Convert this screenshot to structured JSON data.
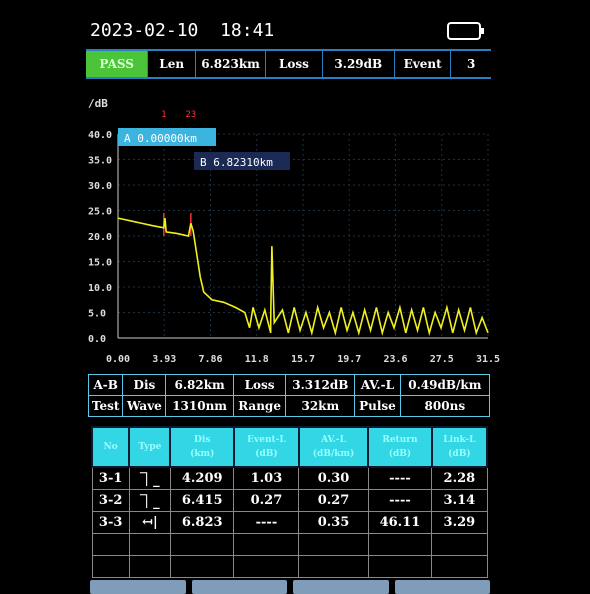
{
  "header": {
    "date": "2023-02-10",
    "time": "18:41",
    "battery_icon": "battery-icon"
  },
  "status": {
    "result": "PASS",
    "len_label": "Len",
    "len_value": "6.823km",
    "loss_label": "Loss",
    "loss_value": "3.29dB",
    "event_label": "Event",
    "event_value": "3"
  },
  "chart_data": {
    "type": "line",
    "ylabel": "/dB",
    "ylim": [
      0,
      40
    ],
    "xlim": [
      0,
      31.5
    ],
    "yticks": [
      "40.0",
      "35.0",
      "30.0",
      "25.0",
      "20.0",
      "15.0",
      "10.0",
      "5.0",
      "0.0"
    ],
    "xticks": [
      "0.00",
      "3.93",
      "7.86",
      "11.8",
      "15.7",
      "19.7",
      "23.6",
      "27.5",
      "31.5"
    ],
    "cursor_a": "A 0.00000km",
    "cursor_b": "B 6.82310km",
    "cursor_a_km": 0,
    "cursor_b_km": 6.8231,
    "event_markers": [
      {
        "label": "1",
        "km": 3.9
      },
      {
        "label": "23",
        "km": 6.2
      }
    ],
    "trace_color": "#f0f020",
    "trace": [
      [
        0,
        23.5
      ],
      [
        1,
        23
      ],
      [
        2,
        22.5
      ],
      [
        3,
        22
      ],
      [
        3.9,
        21.6
      ],
      [
        4.0,
        23.5
      ],
      [
        4.1,
        20.8
      ],
      [
        5,
        20.5
      ],
      [
        6,
        20
      ],
      [
        6.2,
        22.5
      ],
      [
        6.4,
        21
      ],
      [
        6.5,
        19.5
      ],
      [
        6.8,
        15
      ],
      [
        7,
        12
      ],
      [
        7.3,
        9
      ],
      [
        8,
        7.5
      ],
      [
        9,
        7
      ],
      [
        10,
        6
      ],
      [
        10.8,
        5
      ],
      [
        11.2,
        2
      ],
      [
        11.5,
        6
      ],
      [
        12,
        2
      ],
      [
        12.5,
        5.5
      ],
      [
        13,
        1
      ],
      [
        13,
        3.5
      ],
      [
        13.1,
        18
      ],
      [
        13.3,
        3
      ],
      [
        14,
        5.5
      ],
      [
        14.5,
        1
      ],
      [
        15,
        6
      ],
      [
        15.5,
        1.5
      ],
      [
        16,
        5
      ],
      [
        16.5,
        1
      ],
      [
        17,
        6
      ],
      [
        17.5,
        2
      ],
      [
        18,
        5
      ],
      [
        18.5,
        1
      ],
      [
        19,
        6
      ],
      [
        19.5,
        1.5
      ],
      [
        20,
        5
      ],
      [
        20.5,
        1
      ],
      [
        21,
        5.5
      ],
      [
        21.5,
        1.5
      ],
      [
        22,
        6
      ],
      [
        22.5,
        1
      ],
      [
        23,
        5
      ],
      [
        23.5,
        2
      ],
      [
        24,
        6
      ],
      [
        24.5,
        1
      ],
      [
        25,
        5.5
      ],
      [
        25.5,
        1.5
      ],
      [
        26,
        6
      ],
      [
        26.5,
        1
      ],
      [
        27,
        5
      ],
      [
        27.5,
        2
      ],
      [
        28,
        6
      ],
      [
        28.5,
        1
      ],
      [
        29,
        5.5
      ],
      [
        29.5,
        1.5
      ],
      [
        30,
        6
      ],
      [
        30.5,
        1
      ],
      [
        31,
        4
      ],
      [
        31.5,
        1
      ]
    ]
  },
  "info": {
    "rows": [
      [
        "A-B",
        "Dis",
        "6.82km",
        "Loss",
        "3.312dB",
        "AV.-L",
        "0.49dB/km"
      ],
      [
        "Test",
        "Wave",
        "1310nm",
        "Range",
        "32km",
        "Pulse",
        "800ns"
      ]
    ]
  },
  "events": {
    "headers": [
      "No",
      "Type",
      "Dis\n(km)",
      "Event-L\n(dB)",
      "AV.-L\n(dB/km)",
      "Return\n(dB)",
      "Link-L\n(dB)"
    ],
    "rows": [
      [
        "3-1",
        "non-reflective-icon",
        "4.209",
        "1.03",
        "0.30",
        "----",
        "2.28"
      ],
      [
        "3-2",
        "non-reflective-icon",
        "6.415",
        "0.27",
        "0.27",
        "----",
        "3.14"
      ],
      [
        "3-3",
        "fiber-end-icon",
        "6.823",
        "----",
        "0.35",
        "46.11",
        "3.29"
      ]
    ],
    "type_glyphs": {
      "non-reflective-icon": "⏋_",
      "fiber-end-icon": "↤|"
    }
  }
}
